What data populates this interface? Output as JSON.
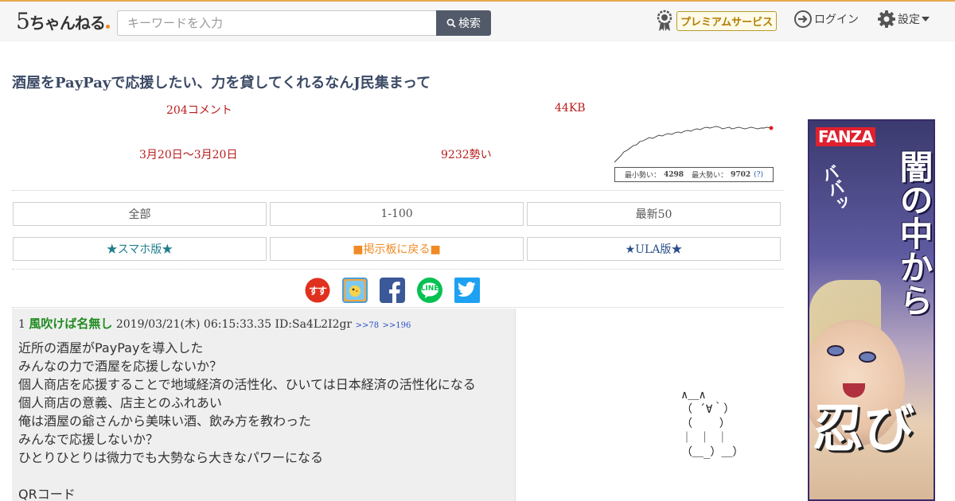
{
  "header": {
    "logo_text": "ちゃんねる",
    "logo_num": "5",
    "search_placeholder": "キーワードを入力",
    "search_button": "検索",
    "premium_label": "プレミアムサービス",
    "login_label": "ログイン",
    "settings_label": "設定"
  },
  "thread": {
    "title": "酒屋をPayPayで応援したい、力を貸してくれるなんJ民集まって",
    "comments": "204コメント",
    "size": "44KB",
    "date_range": "3月20日〜3月20日",
    "momentum": "9232勢い",
    "graph_min_label": "最小勢い：",
    "graph_min": "4298",
    "graph_max_label": "最大勢い：",
    "graph_max": "9702",
    "graph_help": "(?)"
  },
  "nav": {
    "all": "全部",
    "range": "1-100",
    "latest": "最新50",
    "smartphone": "★スマホ版★",
    "back_board": "■掲示板に戻る■",
    "ula": "★ULA版★"
  },
  "social": {
    "sukusuku": "すす",
    "line": "LINE"
  },
  "post": {
    "number": "1",
    "name": "風吹けば名無し",
    "datetime": "2019/03/21(木) 06:15:33.35",
    "id": "ID:Sa4L2I2gr",
    "anchor1": ">>78",
    "anchor2": ">>196",
    "body": "近所の酒屋がPayPayを導入した\nみんなの力で酒屋を応援しないか？\n個人商店を応援することで地域経済の活性化、ひいては日本経済の活性化になる\n個人商店の意義、店主とのふれあい\n俺は酒屋の爺さんから美味い酒、飲み方を教わった\nみんなで応援しないか？\nひとりひとりは微力でも大勢なら大きなパワーになる\n\nQRコード",
    "ascii_art": "∧＿∧\n（ ´∀｀）\n（    ）\n｜ ｜ ｜\n（＿_）＿）"
  },
  "ad": {
    "brand": "FANZA",
    "title_vertical": "闇の中から",
    "title_bottom": "忍び",
    "sfx": "ババッ"
  },
  "colors": {
    "header_accent": "#e8a84c",
    "title": "#3c4a66",
    "meta_red": "#b81c1c",
    "name_green": "#228b22",
    "search_btn": "#525a6a"
  }
}
